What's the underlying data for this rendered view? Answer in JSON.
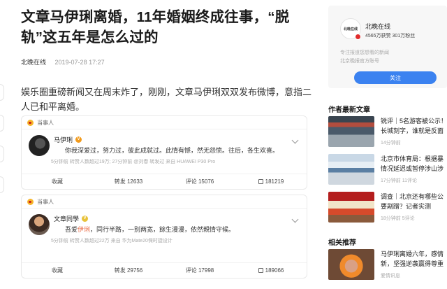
{
  "article": {
    "title": "文章马伊琍离婚，11年婚姻终成往事，“脱轨”这五年是怎么过的",
    "source": "北晚在线",
    "date": "2019-07-28 17:27",
    "lead": "娱乐圈重磅新闻又在周末炸了，刚刚，文章马伊琍双双发布微博，意指二人已和平离婚。"
  },
  "weibo_cards": [
    {
      "header": "当事人",
      "author": "马伊琍",
      "badge": "V",
      "text": "你我深爱过，努力过，彼此成就过。此情有憾，然无怨愤。往后，各生欢喜。",
      "text_highlight": "",
      "text_rest": "",
      "meta": "5分钟前 转赞人数超过19万; 27分钟前 @刘春 转发过  来自 HUAWEI P30 Pro",
      "actions": {
        "collect": "收藏",
        "repost": "转发 12633",
        "comment": "评论 15076",
        "like": "181219"
      }
    },
    {
      "header": "当事人",
      "author": "文章同學",
      "badge": "V",
      "text": "吾爱",
      "text_highlight": "伊琍",
      "text_rest": "，同行半路，一别两宽，餘生漫漫，依然親情守候。",
      "meta": "5分钟前 转赞人数超过22万  来自 华为Mate20保时捷设计",
      "actions": {
        "collect": "收藏",
        "repost": "转发 29756",
        "comment": "评论 17998",
        "like": "189066"
      }
    }
  ],
  "sidebar": {
    "account": {
      "logo_text": "北晚在线",
      "name": "北晚在线",
      "stats": "4565万获赞 301万粉丝",
      "desc_line1": "专注报道您想看的新闻",
      "desc_line2": "北京晚报官方账号",
      "follow_label": "关注"
    },
    "latest_title": "作者最新文章",
    "latest": [
      {
        "line1": "锐评｜5名游客被公示！",
        "line2": "长城刻字，谁就是反面",
        "time": "14分钟前"
      },
      {
        "line1": "北京市体育局：根据暴",
        "line2": "情况延迟或暂停涉山涉",
        "time": "17分钟前  11评论"
      },
      {
        "line1": "调查｜北京还有哪些公",
        "line2": "要剐蹭？记者实测",
        "time": "18分钟前  5评论"
      }
    ],
    "related_title": "相关推荐",
    "related": [
      {
        "line1": "马伊琍离婚六年，感情",
        "line2": "新，坚强逆袭赢得尊重",
        "time": "爱情讯息"
      }
    ]
  }
}
